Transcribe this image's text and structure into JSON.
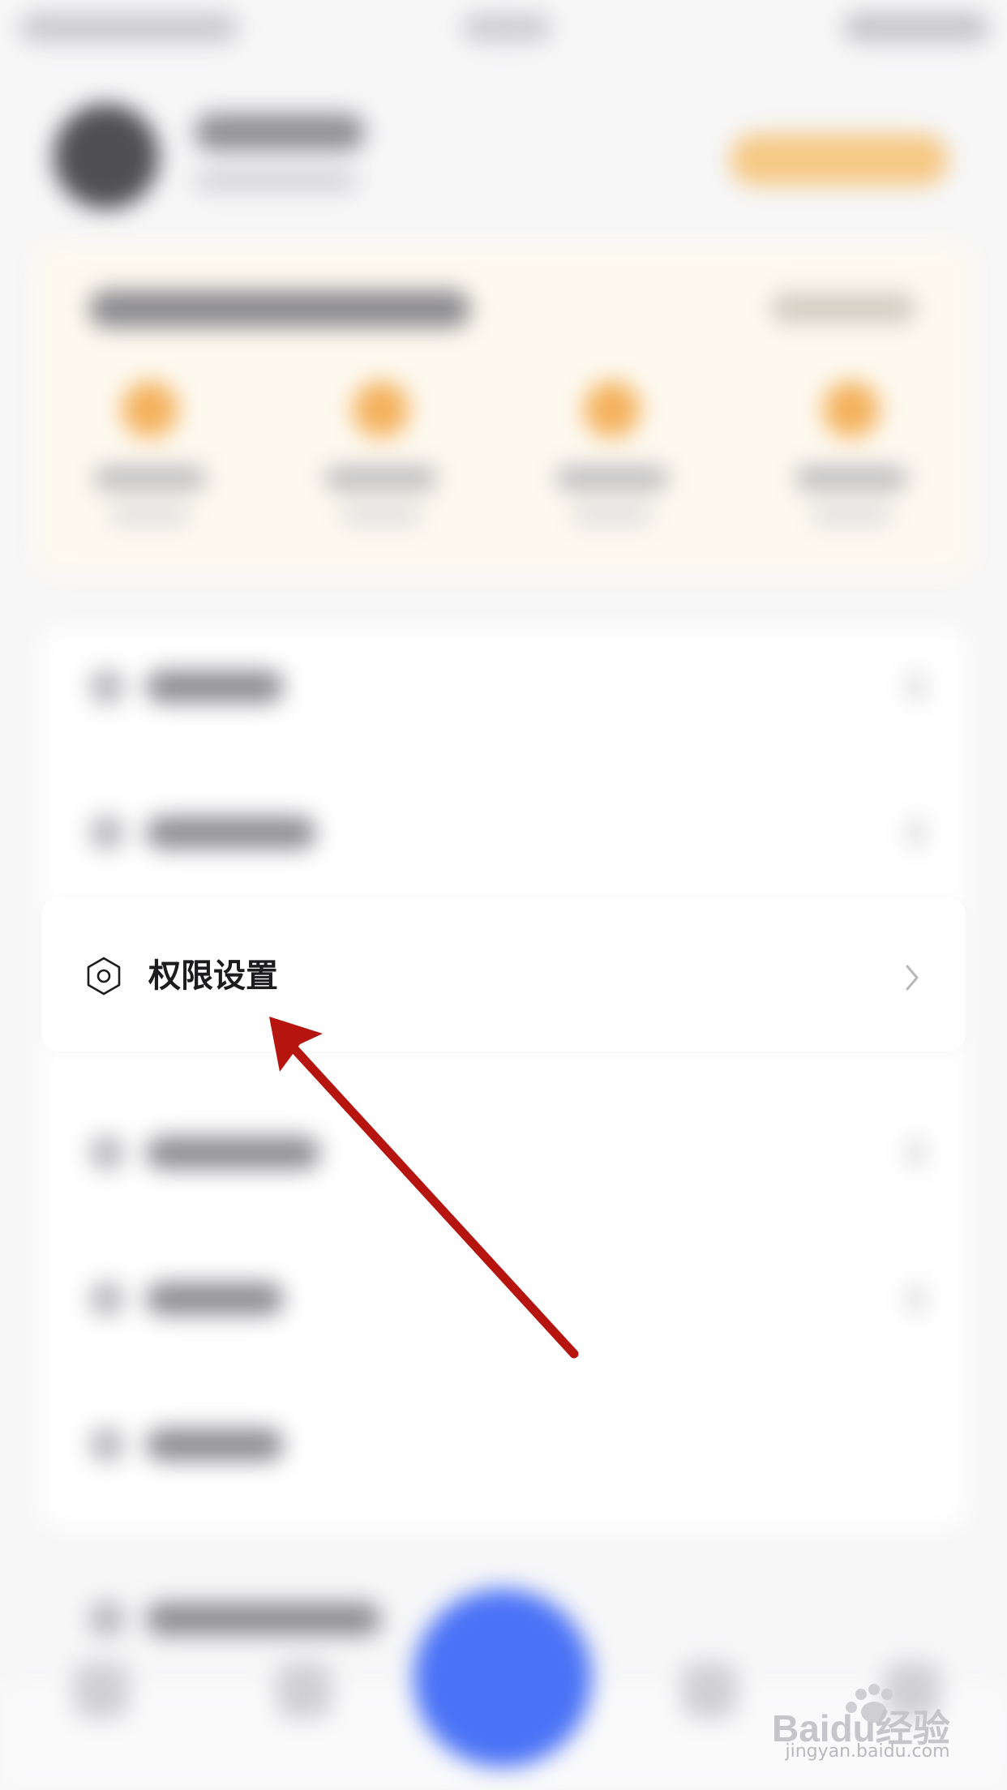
{
  "permission_row": {
    "label": "权限设置",
    "icon": "hexagon-settings-icon",
    "chevron_icon": "chevron-right-icon"
  },
  "watermark": {
    "brand": "Baidu经验",
    "url": "jingyan.baidu.com"
  },
  "colors": {
    "fab": "#4a72f6",
    "vip_accent": "#f6c884",
    "arrow": "#b5140f"
  }
}
